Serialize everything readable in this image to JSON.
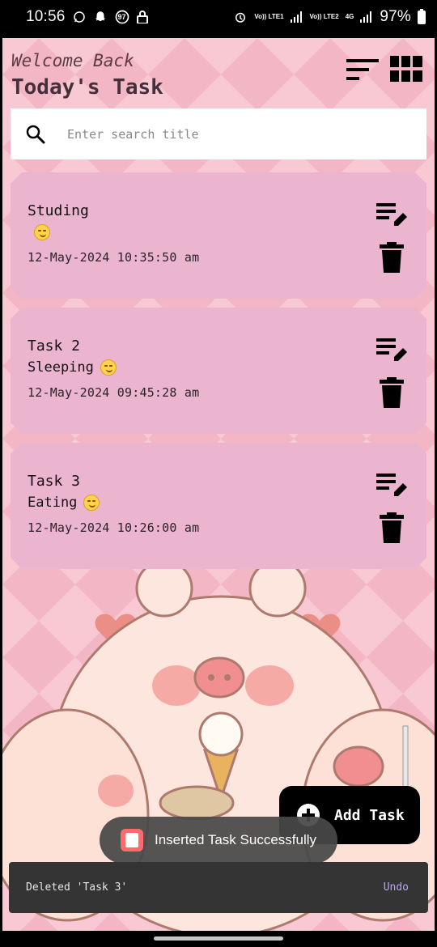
{
  "status_bar": {
    "time": "10:56",
    "notification_badge": "97",
    "network1_label": "Vo)) LTE1",
    "network2_label": "Vo)) LTE2",
    "network2_tech": "4G",
    "battery": "97%",
    "icons": [
      "whatsapp-icon",
      "snapchat-icon",
      "notification-count-badge",
      "lock-icon",
      "alarm-icon",
      "signal-icon",
      "battery-icon"
    ]
  },
  "header": {
    "welcome": "Welcome Back",
    "title": "Today's Task",
    "sort_icon": "sort-icon",
    "grid_icon": "grid-view-icon"
  },
  "search": {
    "placeholder": "Enter search title",
    "value": ""
  },
  "tasks": [
    {
      "title": "Studing",
      "description": "",
      "emoji": "😊",
      "date": "12-May-2024 10:35:50 am"
    },
    {
      "title": "Task 2",
      "description": "Sleeping",
      "emoji": "😴",
      "date": "12-May-2024 09:45:28 am"
    },
    {
      "title": "Task 3",
      "description": "Eating",
      "emoji": "😋",
      "date": "12-May-2024 10:26:00 am"
    }
  ],
  "fab": {
    "label": "Add Task"
  },
  "toast": {
    "text": "Inserted Task Successfully"
  },
  "snackbar": {
    "message": "Deleted 'Task 3'",
    "action": "Undo"
  },
  "colors": {
    "background": "#f7c7d1",
    "card": "#ebb4cf",
    "fab": "#000000",
    "snackbar": "#343434",
    "snackbar_action": "#b9a2ff"
  }
}
